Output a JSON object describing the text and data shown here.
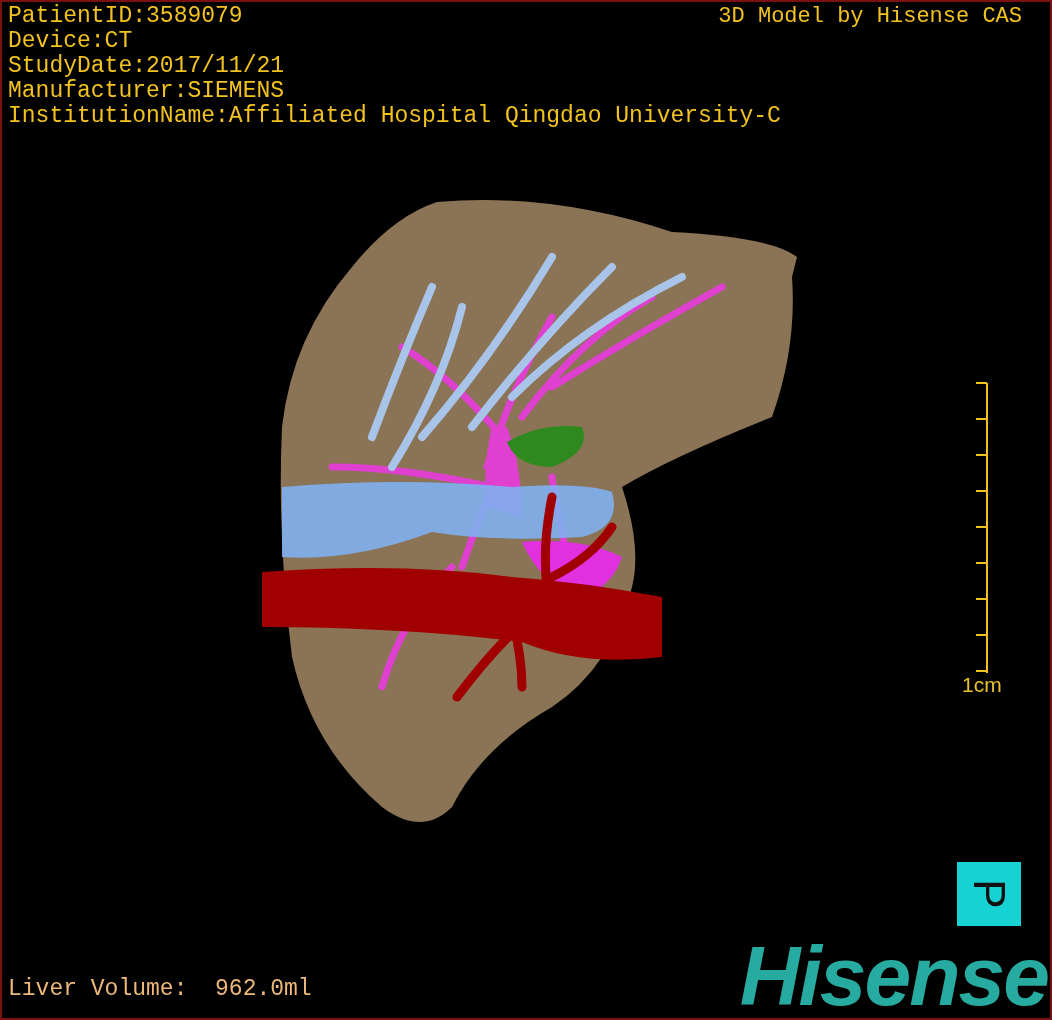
{
  "viewport": {
    "info_lines": [
      "PatientID:3589079",
      "Device:CT",
      "StudyDate:2017/11/21",
      "Manufacturer:SIEMENS",
      "InstitutionName:Affiliated Hospital Qingdao University-C"
    ],
    "title": "3D Model by Hisense CAS",
    "scale_bar": {
      "label": "1cm"
    },
    "orientation_marker": {
      "label": "P"
    },
    "logo": "Hisense",
    "liver_volume": "Liver Volume:  962.0ml"
  }
}
